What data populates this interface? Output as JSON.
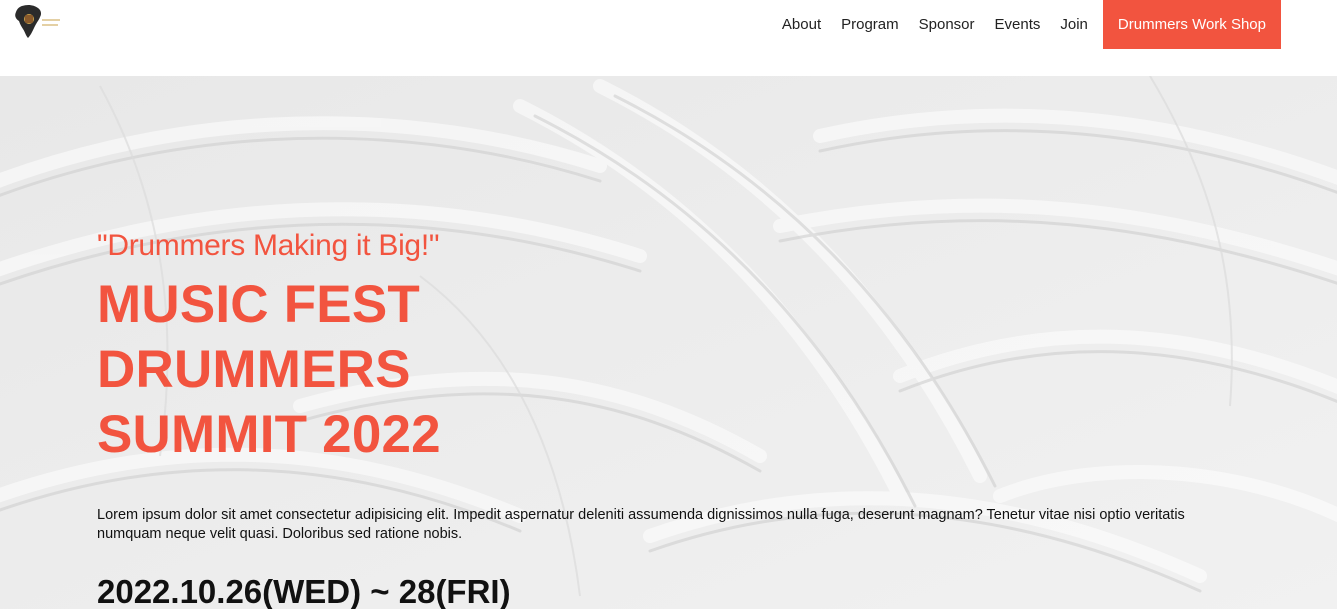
{
  "nav": {
    "logo_icon": "africa-drum-logo-icon",
    "links": [
      "About",
      "Program",
      "Sponsor",
      "Events",
      "Join"
    ],
    "cta_label": "Drummers Work Shop"
  },
  "hero": {
    "tagline": "\"Drummers Making it Big!\"",
    "title_lines": [
      "MUSIC FEST",
      "DRUMMERS",
      "SUMMIT 2022"
    ],
    "description": "Lorem ipsum dolor sit amet consectetur adipisicing elit. Impedit aspernatur deleniti assumenda dignissimos nulla fuga, deserunt magnam? Tenetur vitae nisi optio veritatis numquam neque velit quasi. Doloribus sed ratione nobis.",
    "date": "2022.10.26(WED) ~ 28(FRI)"
  },
  "colors": {
    "accent": "#f2543f",
    "text": "#111111",
    "hero_bg": "#ececec"
  }
}
